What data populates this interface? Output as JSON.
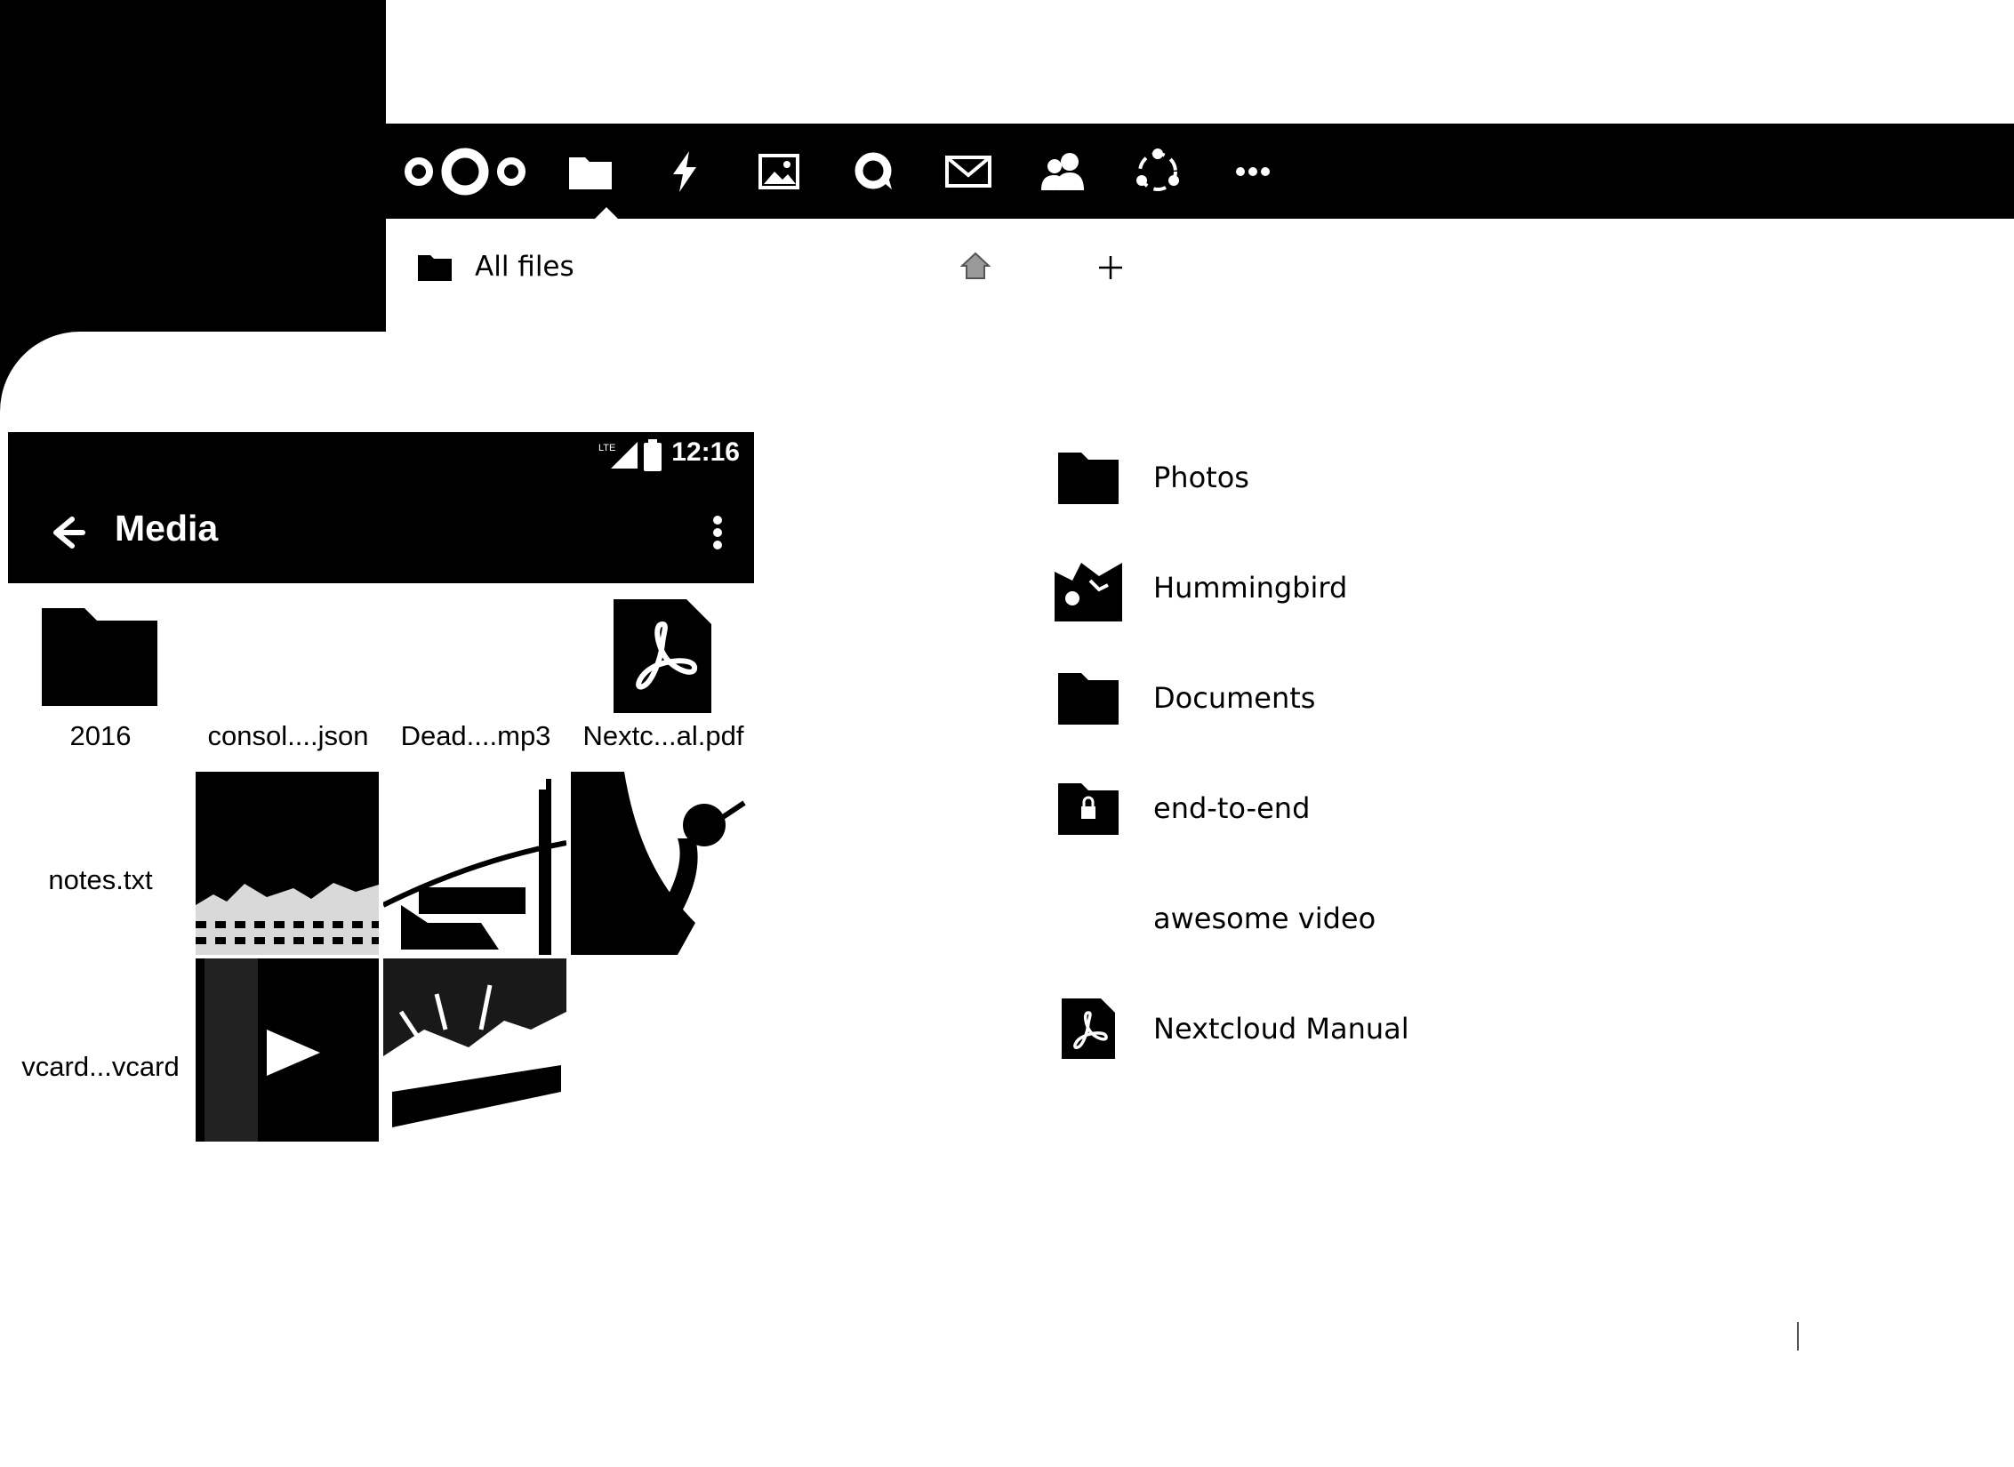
{
  "topbar": {
    "logo": "nextcloud-logo",
    "apps": [
      {
        "name": "files",
        "icon": "folder-icon",
        "active": true
      },
      {
        "name": "activity",
        "icon": "lightning-icon"
      },
      {
        "name": "gallery",
        "icon": "image-icon"
      },
      {
        "name": "talk",
        "icon": "talk-icon"
      },
      {
        "name": "mail",
        "icon": "mail-icon"
      },
      {
        "name": "contacts",
        "icon": "contacts-icon"
      },
      {
        "name": "circles",
        "icon": "circles-icon"
      },
      {
        "name": "more",
        "icon": "more-icon"
      }
    ]
  },
  "breadcrumb": {
    "label": "All files"
  },
  "phone": {
    "status_time": "12:16",
    "title": "Media",
    "grid": [
      {
        "label": "2016",
        "kind": "folder"
      },
      {
        "label": "consol....json",
        "kind": "file"
      },
      {
        "label": "Dead....mp3",
        "kind": "file"
      },
      {
        "label": "Nextc...al.pdf",
        "kind": "pdf"
      },
      {
        "label": "notes.txt",
        "kind": "file"
      },
      {
        "label": "",
        "kind": "image"
      },
      {
        "label": "",
        "kind": "image"
      },
      {
        "label": "",
        "kind": "image"
      },
      {
        "label": "vcard...vcard",
        "kind": "file"
      },
      {
        "label": "",
        "kind": "video"
      },
      {
        "label": "",
        "kind": "image"
      }
    ]
  },
  "files": [
    {
      "name": "Photos",
      "icon": "folder-icon"
    },
    {
      "name": "Hummingbird",
      "icon": "image-thumbnail"
    },
    {
      "name": "Documents",
      "icon": "folder-icon"
    },
    {
      "name": "end-to-end",
      "icon": "locked-folder-icon"
    },
    {
      "name": "awesome video",
      "icon": "none"
    },
    {
      "name": "Nextcloud Manual",
      "icon": "pdf-icon"
    }
  ]
}
